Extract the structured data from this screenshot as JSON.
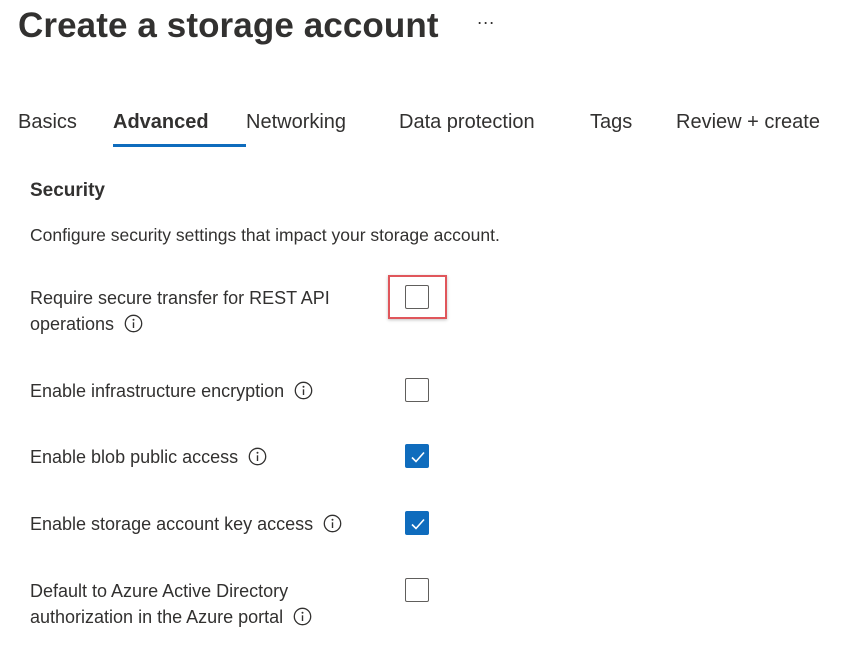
{
  "header": {
    "title": "Create a storage account",
    "more_label": "···"
  },
  "tabs": [
    {
      "label": "Basics",
      "active": false
    },
    {
      "label": "Advanced",
      "active": true
    },
    {
      "label": "Networking",
      "active": false
    },
    {
      "label": "Data protection",
      "active": false
    },
    {
      "label": "Tags",
      "active": false
    },
    {
      "label": "Review + create",
      "active": false
    }
  ],
  "security": {
    "title": "Security",
    "description": "Configure security settings that impact your storage account.",
    "settings": [
      {
        "line1": "Require secure transfer for REST API",
        "line2": "operations",
        "checked": false,
        "highlighted": true
      },
      {
        "line1": "Enable infrastructure encryption",
        "checked": false
      },
      {
        "line1": "Enable blob public access",
        "checked": true
      },
      {
        "line1": "Enable storage account key access",
        "checked": true
      },
      {
        "line1": "Default to Azure Active Directory",
        "line2": "authorization in the Azure portal",
        "checked": false
      }
    ]
  },
  "colors": {
    "accent": "#0f6cbd",
    "highlight": "#e0565b",
    "text": "#323130"
  },
  "icons": {
    "info": "info-circle-icon",
    "check": "checkmark-icon",
    "more": "more-ellipsis-icon"
  }
}
